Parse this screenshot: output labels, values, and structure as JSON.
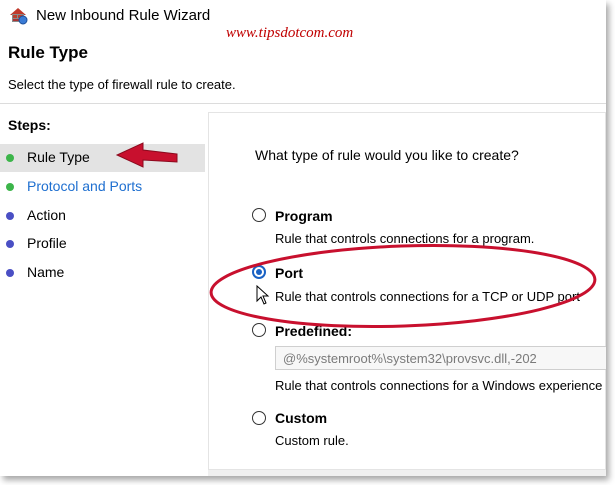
{
  "window": {
    "title": "New Inbound Rule Wizard",
    "icon": "firewall-shield-icon"
  },
  "watermark": "www.tipsdotcom.com",
  "header": {
    "title": "Rule Type",
    "subtitle": "Select the type of firewall rule to create."
  },
  "sidebar": {
    "steps_label": "Steps:",
    "items": [
      {
        "label": "Rule Type",
        "bullet_color": "#3cb54a",
        "text_color": "#000000",
        "active": true
      },
      {
        "label": "Protocol and Ports",
        "bullet_color": "#3cb54a",
        "text_color": "#1e6fd0",
        "active": false
      },
      {
        "label": "Action",
        "bullet_color": "#4a4fc4",
        "text_color": "#000000",
        "active": false
      },
      {
        "label": "Profile",
        "bullet_color": "#4a4fc4",
        "text_color": "#000000",
        "active": false
      },
      {
        "label": "Name",
        "bullet_color": "#4a4fc4",
        "text_color": "#000000",
        "active": false
      }
    ]
  },
  "main": {
    "question": "What type of rule would you like to create?",
    "options": [
      {
        "title": "Program",
        "description": "Rule that controls connections for a program.",
        "selected": false
      },
      {
        "title": "Port",
        "description": "Rule that controls connections for a TCP or UDP port",
        "selected": true
      },
      {
        "title": "Predefined:",
        "description": "Rule that controls connections for a Windows experience",
        "selected": false
      },
      {
        "title": "Custom",
        "description": "Custom rule.",
        "selected": false
      }
    ],
    "predefined_value": "@%systemroot%\\system32\\provsvc.dll,-202"
  },
  "annotations": {
    "color": "#c8102e"
  }
}
